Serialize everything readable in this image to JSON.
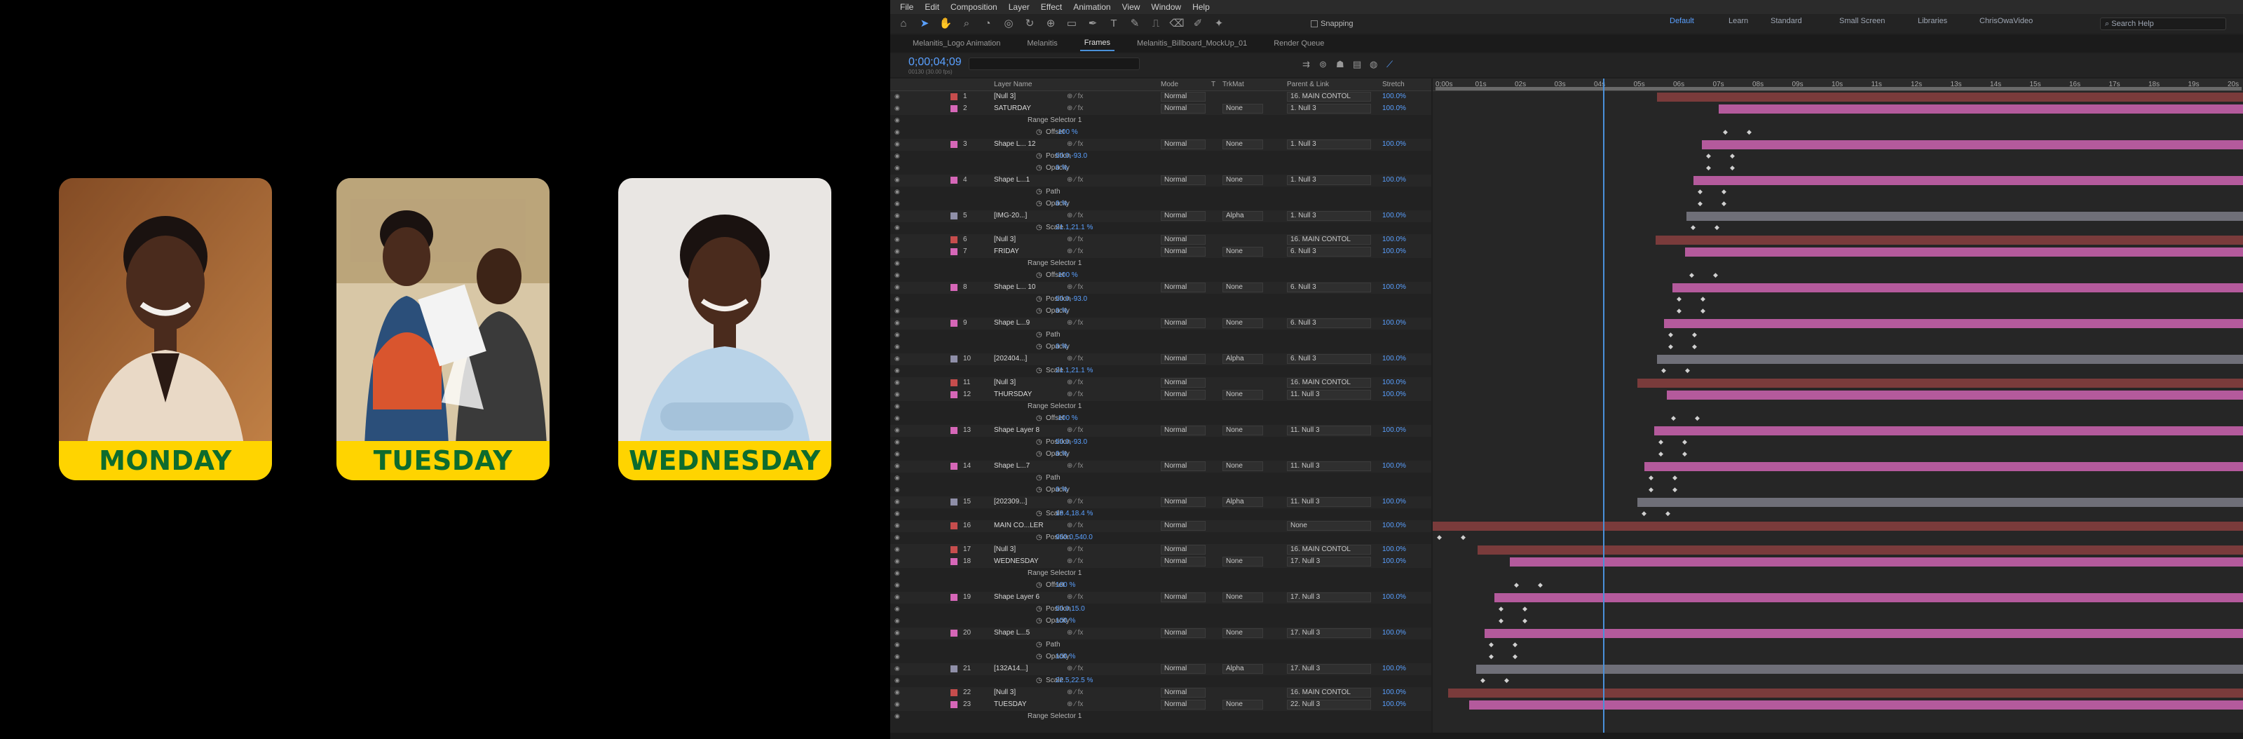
{
  "preview": {
    "cards": [
      {
        "day": "MONDAY",
        "bg": "#8a4f2a",
        "bg2": "#c58b55"
      },
      {
        "day": "TUESDAY",
        "bg": "#b79a72",
        "bg2": "#e6d3b3"
      },
      {
        "day": "WEDNESDAY",
        "bg": "#d9d3cf",
        "bg2": "#f1eeec"
      }
    ],
    "pill_color": "#ffd400",
    "text_color": "#0d6b2e"
  },
  "menu": [
    "File",
    "Edit",
    "Composition",
    "Layer",
    "Effect",
    "Animation",
    "View",
    "Window",
    "Help"
  ],
  "toolbar": {
    "snapping": "Snapping",
    "workspaces": [
      "Default",
      "Learn",
      "Standard",
      "Small Screen",
      "Libraries",
      "ChrisOwaVideo"
    ],
    "search_placeholder": "Search Help"
  },
  "tabs": [
    {
      "label": "Melanitis_Logo Animation",
      "active": false
    },
    {
      "label": "Melanitis",
      "active": false
    },
    {
      "label": "Frames",
      "active": true
    },
    {
      "label": "Melanitis_Billboard_MockUp_01",
      "active": false
    },
    {
      "label": "Render Queue",
      "active": false
    }
  ],
  "timecode": "0;00;04;09",
  "timecode_sub": "00130 (30.00 fps)",
  "columns": {
    "layer_name": "Layer Name",
    "mode": "Mode",
    "t": "T",
    "trkmat": "TrkMat",
    "parent": "Parent & Link",
    "stretch": "Stretch"
  },
  "ruler": [
    "0;00s",
    "01s",
    "02s",
    "03s",
    "04s",
    "05s",
    "06s",
    "07s",
    "08s",
    "09s",
    "10s",
    "11s",
    "12s",
    "13s",
    "14s",
    "15s",
    "16s",
    "17s",
    "18s",
    "19s",
    "20s"
  ],
  "rows": [
    {
      "type": "layer",
      "num": "1",
      "name": "[Null 3]",
      "color": "#c64d4d",
      "mode": "Normal",
      "trk": "",
      "parent": "16. MAIN CONTOL",
      "str": "100.0%",
      "bar": [
        320,
        1156
      ],
      "bc": "#7a3b3b"
    },
    {
      "type": "layer",
      "num": "2",
      "name": "SATURDAY",
      "color": "#d667b8",
      "mode": "Normal",
      "trk": "None",
      "parent": "1. Null 3",
      "str": "100.0%",
      "bar": [
        408,
        1156
      ],
      "bc": "#b45a9c"
    },
    {
      "type": "prop",
      "indent": 186,
      "name": "Range Selector 1",
      "val": ""
    },
    {
      "type": "prop",
      "indent": 212,
      "name": "Offset",
      "val": "-100 %"
    },
    {
      "type": "layer",
      "num": "3",
      "name": "Shape L... 12",
      "color": "#d667b8",
      "mode": "Normal",
      "trk": "None",
      "parent": "1. Null 3",
      "str": "100.0%",
      "bar": [
        384,
        1156
      ],
      "bc": "#b45a9c"
    },
    {
      "type": "prop",
      "indent": 212,
      "name": "Position",
      "val": "50.0,-93.0"
    },
    {
      "type": "prop",
      "indent": 212,
      "name": "Opacity",
      "val": "0 %"
    },
    {
      "type": "layer",
      "num": "4",
      "name": "Shape L...1",
      "color": "#d667b8",
      "mode": "Normal",
      "trk": "None",
      "parent": "1. Null 3",
      "str": "100.0%",
      "bar": [
        372,
        1156
      ],
      "bc": "#b45a9c"
    },
    {
      "type": "prop",
      "indent": 212,
      "name": "Path",
      "val": ""
    },
    {
      "type": "prop",
      "indent": 212,
      "name": "Opacity",
      "val": "0 %"
    },
    {
      "type": "layer",
      "num": "5",
      "name": "[IMG-20...]",
      "color": "#8f8fa8",
      "mode": "Normal",
      "trk": "Alpha",
      "parent": "1. Null 3",
      "str": "100.0%",
      "bar": [
        362,
        1156
      ],
      "bc": "#6f6f78"
    },
    {
      "type": "prop",
      "indent": 212,
      "name": "Scale",
      "val": "21.1,21.1 %"
    },
    {
      "type": "layer",
      "num": "6",
      "name": "[Null 3]",
      "color": "#c64d4d",
      "mode": "Normal",
      "trk": "",
      "parent": "16. MAIN CONTOL",
      "str": "100.0%",
      "bar": [
        318,
        1156
      ],
      "bc": "#7a3b3b"
    },
    {
      "type": "layer",
      "num": "7",
      "name": "FRIDAY",
      "color": "#d667b8",
      "mode": "Normal",
      "trk": "None",
      "parent": "6. Null 3",
      "str": "100.0%",
      "bar": [
        360,
        1156
      ],
      "bc": "#b45a9c"
    },
    {
      "type": "prop",
      "indent": 186,
      "name": "Range Selector 1",
      "val": ""
    },
    {
      "type": "prop",
      "indent": 212,
      "name": "Offset",
      "val": "-100 %"
    },
    {
      "type": "layer",
      "num": "8",
      "name": "Shape L... 10",
      "color": "#d667b8",
      "mode": "Normal",
      "trk": "None",
      "parent": "6. Null 3",
      "str": "100.0%",
      "bar": [
        342,
        1156
      ],
      "bc": "#b45a9c"
    },
    {
      "type": "prop",
      "indent": 212,
      "name": "Position",
      "val": "50.0,-93.0"
    },
    {
      "type": "prop",
      "indent": 212,
      "name": "Opacity",
      "val": "0 %"
    },
    {
      "type": "layer",
      "num": "9",
      "name": "Shape L...9",
      "color": "#d667b8",
      "mode": "Normal",
      "trk": "None",
      "parent": "6. Null 3",
      "str": "100.0%",
      "bar": [
        330,
        1156
      ],
      "bc": "#b45a9c"
    },
    {
      "type": "prop",
      "indent": 212,
      "name": "Path",
      "val": ""
    },
    {
      "type": "prop",
      "indent": 212,
      "name": "Opacity",
      "val": "0 %"
    },
    {
      "type": "layer",
      "num": "10",
      "name": "[202404...]",
      "color": "#8f8fa8",
      "mode": "Normal",
      "trk": "Alpha",
      "parent": "6. Null 3",
      "str": "100.0%",
      "bar": [
        320,
        1156
      ],
      "bc": "#6f6f78"
    },
    {
      "type": "prop",
      "indent": 212,
      "name": "Scale",
      "val": "21.1,21.1 %"
    },
    {
      "type": "layer",
      "num": "11",
      "name": "[Null 3]",
      "color": "#c64d4d",
      "mode": "Normal",
      "trk": "",
      "parent": "16. MAIN CONTOL",
      "str": "100.0%",
      "bar": [
        292,
        1156
      ],
      "bc": "#7a3b3b"
    },
    {
      "type": "layer",
      "num": "12",
      "name": "THURSDAY",
      "color": "#d667b8",
      "mode": "Normal",
      "trk": "None",
      "parent": "11. Null 3",
      "str": "100.0%",
      "bar": [
        334,
        1156
      ],
      "bc": "#b45a9c"
    },
    {
      "type": "prop",
      "indent": 186,
      "name": "Range Selector 1",
      "val": ""
    },
    {
      "type": "prop",
      "indent": 212,
      "name": "Offset",
      "val": "-100 %"
    },
    {
      "type": "layer",
      "num": "13",
      "name": "Shape Layer 8",
      "color": "#d667b8",
      "mode": "Normal",
      "trk": "None",
      "parent": "11. Null 3",
      "str": "100.0%",
      "bar": [
        316,
        1156
      ],
      "bc": "#b45a9c"
    },
    {
      "type": "prop",
      "indent": 212,
      "name": "Position",
      "val": "50.0,-93.0"
    },
    {
      "type": "prop",
      "indent": 212,
      "name": "Opacity",
      "val": "0 %"
    },
    {
      "type": "layer",
      "num": "14",
      "name": "Shape L...7",
      "color": "#d667b8",
      "mode": "Normal",
      "trk": "None",
      "parent": "11. Null 3",
      "str": "100.0%",
      "bar": [
        302,
        1156
      ],
      "bc": "#b45a9c"
    },
    {
      "type": "prop",
      "indent": 212,
      "name": "Path",
      "val": ""
    },
    {
      "type": "prop",
      "indent": 212,
      "name": "Opacity",
      "val": "0 %"
    },
    {
      "type": "layer",
      "num": "15",
      "name": "[202309...]",
      "color": "#8f8fa8",
      "mode": "Normal",
      "trk": "Alpha",
      "parent": "11. Null 3",
      "str": "100.0%",
      "bar": [
        292,
        1156
      ],
      "bc": "#6f6f78"
    },
    {
      "type": "prop",
      "indent": 212,
      "name": "Scale",
      "val": "18.4,18.4 %"
    },
    {
      "type": "layer",
      "num": "16",
      "name": "MAIN CO...LER",
      "color": "#c64d4d",
      "mode": "Normal",
      "trk": "",
      "parent": "None",
      "str": "100.0%",
      "bar": [
        0,
        1156
      ],
      "bc": "#7a3b3b"
    },
    {
      "type": "prop",
      "indent": 212,
      "name": "Position",
      "val": "960.0,540.0"
    },
    {
      "type": "layer",
      "num": "17",
      "name": "[Null 3]",
      "color": "#c64d4d",
      "mode": "Normal",
      "trk": "",
      "parent": "16. MAIN CONTOL",
      "str": "100.0%",
      "bar": [
        64,
        1156
      ],
      "bc": "#7a3b3b"
    },
    {
      "type": "layer",
      "num": "18",
      "name": "WEDNESDAY",
      "color": "#d667b8",
      "mode": "Normal",
      "trk": "None",
      "parent": "17. Null 3",
      "str": "100.0%",
      "bar": [
        110,
        1156
      ],
      "bc": "#b45a9c"
    },
    {
      "type": "prop",
      "indent": 186,
      "name": "Range Selector 1",
      "val": ""
    },
    {
      "type": "prop",
      "indent": 212,
      "name": "Offset",
      "val": "100 %"
    },
    {
      "type": "layer",
      "num": "19",
      "name": "Shape Layer 6",
      "color": "#d667b8",
      "mode": "Normal",
      "trk": "None",
      "parent": "17. Null 3",
      "str": "100.0%",
      "bar": [
        88,
        1156
      ],
      "bc": "#b45a9c"
    },
    {
      "type": "prop",
      "indent": 212,
      "name": "Position",
      "val": "50.0,15.0"
    },
    {
      "type": "prop",
      "indent": 212,
      "name": "Opacity",
      "val": "100 %"
    },
    {
      "type": "layer",
      "num": "20",
      "name": "Shape L...5",
      "color": "#d667b8",
      "mode": "Normal",
      "trk": "None",
      "parent": "17. Null 3",
      "str": "100.0%",
      "bar": [
        74,
        1156
      ],
      "bc": "#b45a9c"
    },
    {
      "type": "prop",
      "indent": 212,
      "name": "Path",
      "val": ""
    },
    {
      "type": "prop",
      "indent": 212,
      "name": "Opacity",
      "val": "100 %"
    },
    {
      "type": "layer",
      "num": "21",
      "name": "[132A14...]",
      "color": "#8f8fa8",
      "mode": "Normal",
      "trk": "Alpha",
      "parent": "17. Null 3",
      "str": "100.0%",
      "bar": [
        62,
        1156
      ],
      "bc": "#6f6f78"
    },
    {
      "type": "prop",
      "indent": 212,
      "name": "Scale",
      "val": "22.5,22.5 %"
    },
    {
      "type": "layer",
      "num": "22",
      "name": "[Null 3]",
      "color": "#c64d4d",
      "mode": "Normal",
      "trk": "",
      "parent": "16. MAIN CONTOL",
      "str": "100.0%",
      "bar": [
        22,
        1156
      ],
      "bc": "#7a3b3b"
    },
    {
      "type": "layer",
      "num": "23",
      "name": "TUESDAY",
      "color": "#d667b8",
      "mode": "Normal",
      "trk": "None",
      "parent": "22. Null 3",
      "str": "100.0%",
      "bar": [
        52,
        1156
      ],
      "bc": "#b45a9c"
    },
    {
      "type": "prop",
      "indent": 186,
      "name": "Range Selector 1",
      "val": ""
    }
  ]
}
